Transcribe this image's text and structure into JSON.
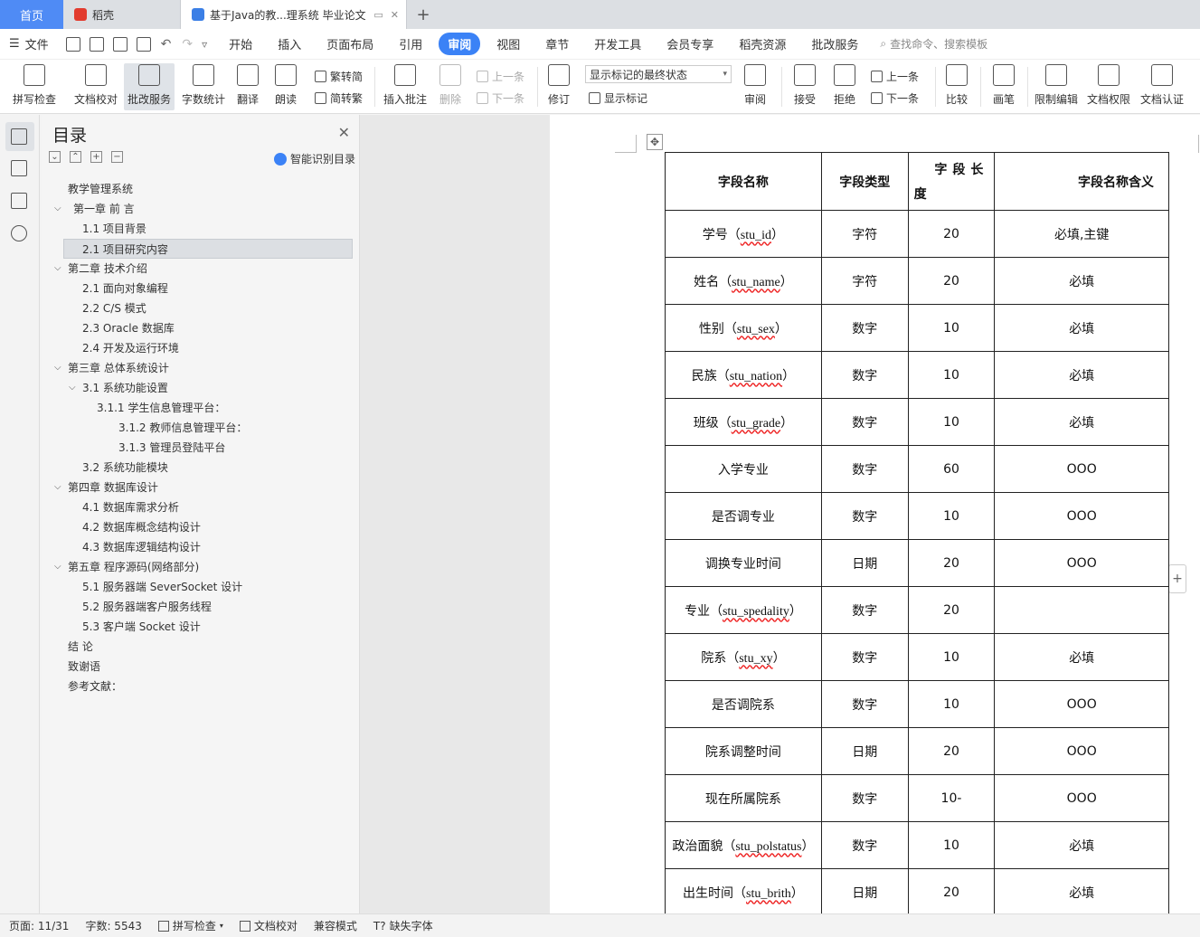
{
  "tabs": {
    "home": "首页",
    "t1": "稻壳",
    "t2": "基于Java的教...理系统 毕业论文"
  },
  "menubar": {
    "file": "文件",
    "items": [
      "开始",
      "插入",
      "页面布局",
      "引用",
      "审阅",
      "视图",
      "章节",
      "开发工具",
      "会员专享",
      "稻壳资源",
      "批改服务"
    ],
    "search": "查找命令、搜索模板"
  },
  "ribbon": {
    "spell": "拼写检查",
    "proof": "文档校对",
    "correct": "批改服务",
    "wordcount": "字数统计",
    "translate": "翻译",
    "read": "朗读",
    "trad": "繁转简",
    "simp": "简转繁",
    "insert_comment": "插入批注",
    "delete": "删除",
    "prev": "上一条",
    "next": "下一条",
    "revise": "修订",
    "display_select": "显示标记的最终状态",
    "show_marks": "显示标记",
    "review": "审阅",
    "accept": "接受",
    "reject": "拒绝",
    "prev2": "上一条",
    "next2": "下一条",
    "compare": "比较",
    "pen": "画笔",
    "restrict": "限制编辑",
    "perm": "文档权限",
    "cert": "文档认证"
  },
  "toc": {
    "title": "目录",
    "ai": "智能识别目录",
    "items": [
      {
        "label": "教学管理系统"
      },
      {
        "label": "第一章  前    言"
      },
      {
        "label": "1.1    项目背景"
      },
      {
        "label": "2.1  项目研究内容"
      },
      {
        "label": "第二章  技术介绍"
      },
      {
        "label": "2.1  面向对象编程"
      },
      {
        "label": "2.2 C/S 模式"
      },
      {
        "label": "2.3 Oracle  数据库"
      },
      {
        "label": "2.4  开发及运行环境"
      },
      {
        "label": "第三章  总体系统设计"
      },
      {
        "label": "3.1  系统功能设置"
      },
      {
        "label": "3.1.1  学生信息管理平台："
      },
      {
        "label": "3.1.2  教师信息管理平台："
      },
      {
        "label": "3.1.3  管理员登陆平台"
      },
      {
        "label": "3.2  系统功能模块"
      },
      {
        "label": "第四章  数据库设计"
      },
      {
        "label": "4.1  数据库需求分析"
      },
      {
        "label": "4.2  数据库概念结构设计"
      },
      {
        "label": "4.3  数据库逻辑结构设计"
      },
      {
        "label": "第五章  程序源码(网络部分)"
      },
      {
        "label": "5.1  服务器端 SeverSocket 设计"
      },
      {
        "label": "5.2  服务器端客户服务线程"
      },
      {
        "label": "5.3  客户端 Socket 设计"
      },
      {
        "label": "结    论"
      },
      {
        "label": "致谢语"
      },
      {
        "label": "参考文献："
      }
    ]
  },
  "table": {
    "headers": {
      "name": "字段名称",
      "type": "字段类型",
      "len_a": "字段长",
      "len_b": "度",
      "meaning": "字段名称含义"
    },
    "rows": [
      {
        "name": "学号（",
        "code": "stu_id",
        "end": "）",
        "type": "字符",
        "len": "20",
        "meaning": "必填,主键"
      },
      {
        "name": "姓名（",
        "code": "stu_name",
        "end": "）",
        "type": "字符",
        "len": "20",
        "meaning": "必填"
      },
      {
        "name": "性别（",
        "code": "stu_sex",
        "end": "）",
        "type": "数字",
        "len": "10",
        "meaning": "必填"
      },
      {
        "name": "民族（",
        "code": "stu_nation",
        "end": "）",
        "type": "数字",
        "len": "10",
        "meaning": "必填"
      },
      {
        "name": "班级（",
        "code": "stu_grade",
        "end": "）",
        "type": "数字",
        "len": "10",
        "meaning": "必填"
      },
      {
        "name": "入学专业",
        "code": "",
        "end": "",
        "type": "数字",
        "len": "60",
        "meaning": "OOO"
      },
      {
        "name": "是否调专业",
        "code": "",
        "end": "",
        "type": "数字",
        "len": "10",
        "meaning": "OOO"
      },
      {
        "name": "调换专业时间",
        "code": "",
        "end": "",
        "type": "日期",
        "len": "20",
        "meaning": "OOO"
      },
      {
        "name": "专业（",
        "code": "stu_spedality",
        "end": "）",
        "type": "数字",
        "len": "20",
        "meaning": ""
      },
      {
        "name": "院系（",
        "code": "stu_xy",
        "end": "）",
        "type": "数字",
        "len": "10",
        "meaning": "必填"
      },
      {
        "name": "是否调院系",
        "code": "",
        "end": "",
        "type": "数字",
        "len": "10",
        "meaning": "OOO"
      },
      {
        "name": "院系调整时间",
        "code": "",
        "end": "",
        "type": "日期",
        "len": "20",
        "meaning": "OOO"
      },
      {
        "name": "现在所属院系",
        "code": "",
        "end": "",
        "type": "数字",
        "len": "10-",
        "meaning": "OOO"
      },
      {
        "name": "政治面貌（",
        "code": "stu_polstatus",
        "end": "）",
        "type": "数字",
        "len": "10",
        "meaning": "必填"
      },
      {
        "name": "出生时间（",
        "code": "stu_brith",
        "end": "）",
        "type": "日期",
        "len": "20",
        "meaning": "必填"
      }
    ]
  },
  "status": {
    "page": "页面: 11/31",
    "words": "字数: 5543",
    "spell": "拼写检查",
    "proof": "文档校对",
    "compat": "兼容模式",
    "missing_font": "缺失字体"
  }
}
